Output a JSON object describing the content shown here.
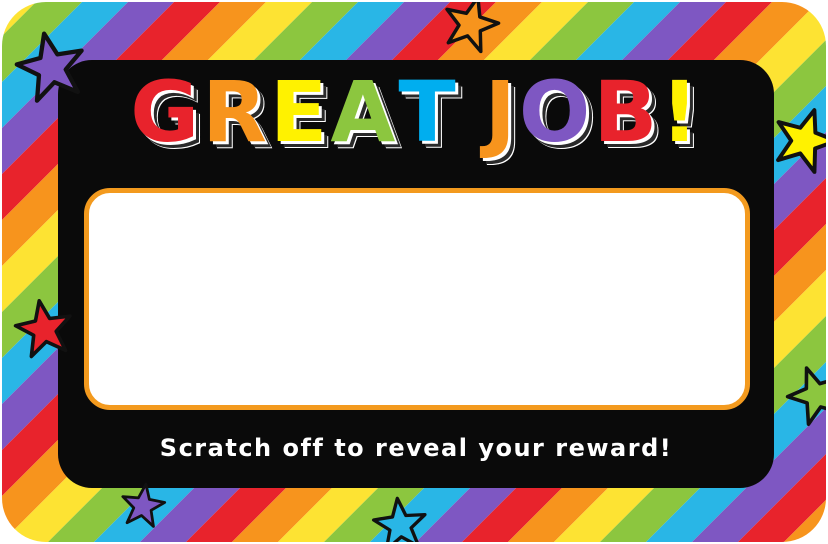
{
  "card": {
    "title_letters": [
      "G",
      "R",
      "E",
      "A",
      "T",
      " ",
      "J",
      "O",
      "B",
      "!"
    ],
    "title_colors": [
      "#e8232c",
      "#f7941d",
      "#fff200",
      "#8cc63f",
      "#00aeef",
      "",
      "#f7941d",
      "#7e57c2",
      "#e8232c",
      "#fff200"
    ],
    "caption": "Scratch off to reveal your reward!"
  },
  "colors": {
    "stripes": [
      "#e8232c",
      "#f7941d",
      "#fde333",
      "#8cc63f",
      "#29b6e6",
      "#7e57c2"
    ],
    "panel": "#0a0a0a",
    "scratch_border": "#f39a1e"
  },
  "decorations": {
    "stars": [
      {
        "name": "purple-star-icon",
        "color": "#7e57c2"
      },
      {
        "name": "orange-star-icon",
        "color": "#f7941d"
      },
      {
        "name": "yellow-star-icon",
        "color": "#fff200"
      },
      {
        "name": "rainbow-star-icon",
        "color": "#e8232c"
      },
      {
        "name": "green-star-icon",
        "color": "#8cc63f"
      },
      {
        "name": "purple-star-small-icon",
        "color": "#7e57c2"
      },
      {
        "name": "blue-star-icon",
        "color": "#29b6e6"
      }
    ]
  }
}
